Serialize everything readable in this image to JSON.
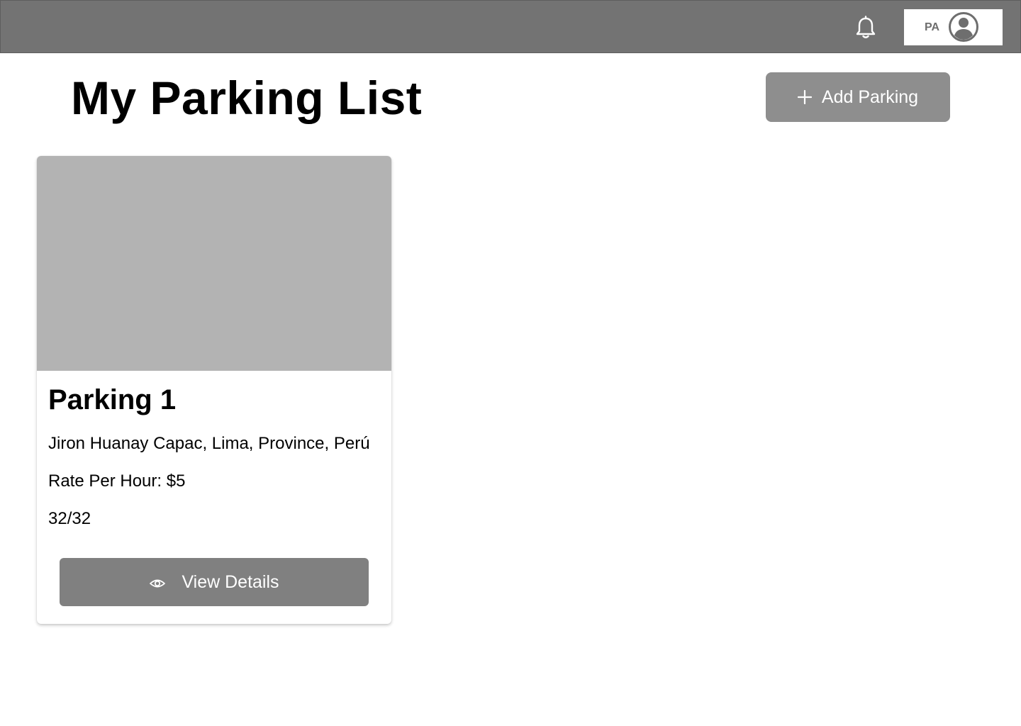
{
  "header": {
    "icons": {
      "notifications": "bell-icon",
      "avatar": "user-circle-icon"
    },
    "user": {
      "initials": "PA"
    }
  },
  "page": {
    "title": "My Parking List",
    "add_button": {
      "label": "Add Parking",
      "icon": "plus-icon"
    }
  },
  "parkings": [
    {
      "name": "Parking 1",
      "address": "Jiron Huanay Capac, Lima, Province, Perú",
      "rate": "Rate Per Hour: $5",
      "capacity": "32/32",
      "button_label": "View Details",
      "button_icon": "eye-icon"
    }
  ],
  "colors": {
    "topbar": "#737373",
    "primary_button": "#8e8e8e",
    "card_button": "#808080",
    "image_placeholder": "#b3b3b3"
  }
}
